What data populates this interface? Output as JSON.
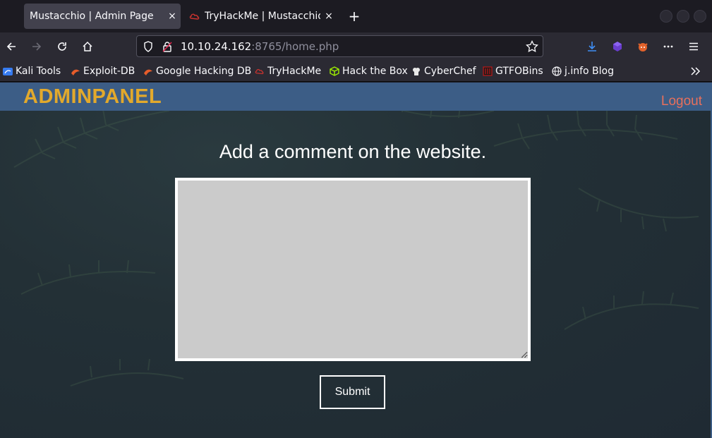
{
  "browser": {
    "tabs": [
      {
        "title": "Mustacchio | Admin Page",
        "active": true
      },
      {
        "title": "TryHackMe | Mustacchio",
        "active": false
      }
    ],
    "new_tab_symbol": "+",
    "close_symbol": "×",
    "url": {
      "host": "10.10.24.162",
      "rest": ":8765/home.php"
    },
    "bookmarks": [
      {
        "label": "Kali Tools",
        "icon": "kali-icon"
      },
      {
        "label": "Exploit-DB",
        "icon": "exploit-db-icon"
      },
      {
        "label": "Google Hacking DB",
        "icon": "ghdb-icon"
      },
      {
        "label": "TryHackMe",
        "icon": "tryhackme-icon"
      },
      {
        "label": "Hack the Box",
        "icon": "htb-icon"
      },
      {
        "label": "CyberChef",
        "icon": "cyberchef-icon"
      },
      {
        "label": "GTFOBins",
        "icon": "gtfobins-icon"
      },
      {
        "label": "j.info Blog",
        "icon": "globe-icon"
      }
    ],
    "colors": {
      "chrome_bg": "#1c1b22",
      "toolbar_bg": "#2b2a33",
      "active_tab": "#42414d"
    }
  },
  "page": {
    "brand": "ADMINPANEL",
    "logout_label": "Logout",
    "heading": "Add a comment on the website.",
    "comment_value": "",
    "submit_label": "Submit",
    "colors": {
      "navbar": "#3c5d86",
      "brand": "#e2a92c",
      "logout": "#e8705c",
      "textarea": "#cbcbcb"
    }
  }
}
